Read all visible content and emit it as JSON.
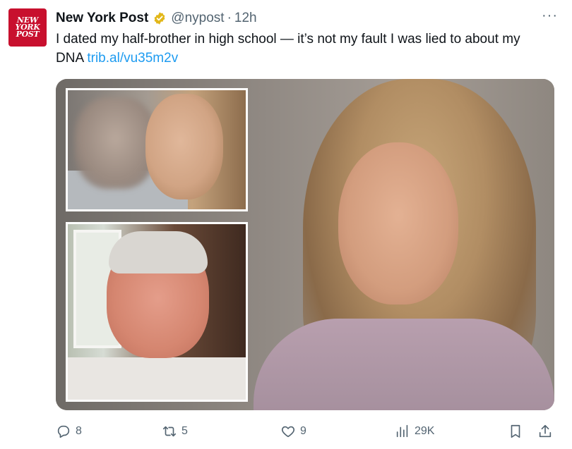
{
  "account": {
    "avatar_lines": [
      "NEW",
      "YORK",
      "POST"
    ],
    "display_name": "New York Post",
    "handle": "@nypost",
    "separator": "·",
    "time": "12h",
    "verified_badge": "gold-verified-icon",
    "more_label": "···"
  },
  "tweet": {
    "text": "I dated my half-brother in high school — it’s not my fault I was lied to about my DNA",
    "link": "trib.al/vu35m2v"
  },
  "media": {
    "description_icon": "photo-collage"
  },
  "actions": {
    "replies": "8",
    "retweets": "5",
    "likes": "9",
    "views": "29K"
  },
  "colors": {
    "brand_red": "#c8102e",
    "link_blue": "#1d9bf0",
    "muted": "#536471",
    "verified_gold": "#e2b719"
  }
}
